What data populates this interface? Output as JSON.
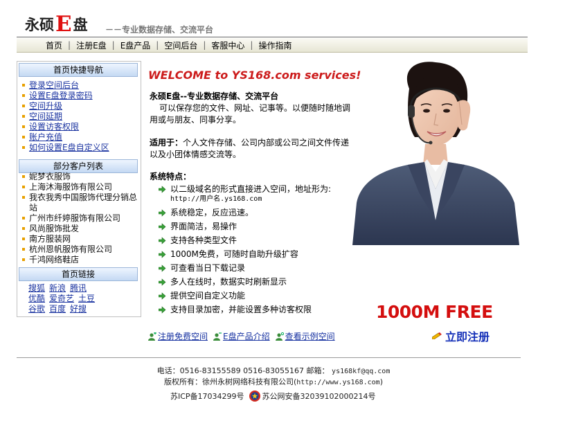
{
  "header": {
    "logo_part1": "永硕",
    "logo_e": "E",
    "logo_part2": "盘",
    "slogan": "－－专业数据存储、交流平台"
  },
  "nav": [
    "首页",
    "注册E盘",
    "E盘产品",
    "空间后台",
    "客服中心",
    "操作指南"
  ],
  "sidebar": {
    "quick_title": "首页快捷导航",
    "quick_items": [
      "登录空间后台",
      "设置E盘登录密码",
      "空间升级",
      "空间延期",
      "设置访客权限",
      "账户充值",
      "如何设置E盘自定义区"
    ],
    "clients_title": "部分客户列表",
    "clients": [
      "妮梦衣服饰",
      "上海沐海服饰有限公司",
      "我衣我秀中国服饰代理分销总站",
      "广州市纤婷服饰有限公司",
      "风尚服饰批发",
      "南方服装网",
      "杭州恩帆服饰有限公司",
      "千鸿网络鞋店"
    ],
    "links_title": "首页链接",
    "links_row1": [
      "搜狐",
      "新浪",
      "腾讯"
    ],
    "links_row2": [
      "优酷",
      "爱奇艺",
      "土豆"
    ],
    "links_row3": [
      "谷歌",
      "百度",
      "好搜"
    ]
  },
  "main": {
    "welcome": "WELCOME to YS168.com services!",
    "intro_title": "永硕E盘--专业数据存储、交流平台",
    "intro_body": "可以保存您的文件、网址、记事等。以便随时随地调用或与朋友、同事分享。",
    "use_label": "适用于：",
    "use_text": "个人文件存储、公司内部或公司之间文件传递以及小团体情感交流等。",
    "features_title": "系统特点：",
    "feature_first": "以二级域名的形式直接进入空间，地址形为:",
    "feature_first_url": "http://用户名.ys168.com",
    "features": [
      "系统稳定，反应迅速。",
      "界面简洁，易操作",
      "支持各种类型文件",
      "1000M免费，可随时自助升级扩容",
      "可查看当日下载记录",
      "多人在线时，数据实时刷新显示",
      "提供空间自定义功能",
      "支持目录加密，并能设置多种访客权限"
    ],
    "free_text": "1000M FREE",
    "register_now": "立即注册",
    "bottom_links": [
      "注册免费空间",
      "E盘产品介绍",
      "查看示例空间"
    ]
  },
  "footer": {
    "phone": "电话：0516-83155589 0516-83055167 邮箱：",
    "email": "ys168kf@qq.com",
    "copyright": "版权所有：徐州永树网络科技有限公司(",
    "copyright_url": "http://www.ys168.com",
    "copyright_end": ")",
    "icp": "苏ICP备17034299号",
    "police": "苏公网安备32039102000214号"
  },
  "colors": {
    "accent_red": "#cc1b1b",
    "link_blue": "#1a33a0",
    "sidebar_header": "#c4d9f3"
  }
}
